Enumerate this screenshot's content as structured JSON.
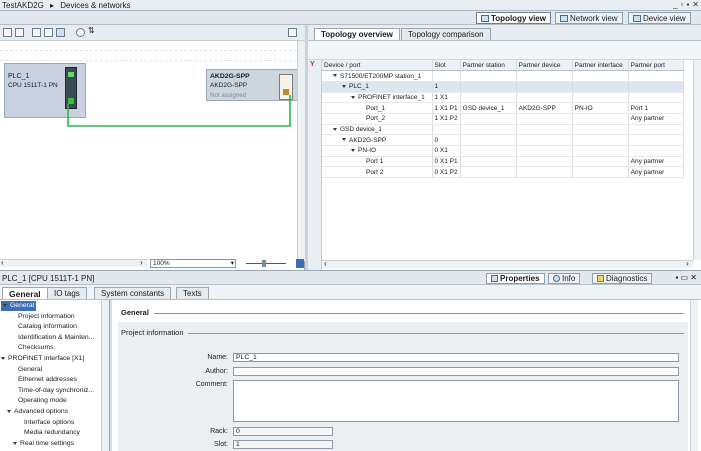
{
  "titlebar": {
    "project": "TestAKD2G",
    "separator": "▸",
    "section": "Devices & networks",
    "win_controls": [
      "_",
      "▫",
      "▪",
      "✕"
    ]
  },
  "view_tabs": {
    "topology": "Topology view",
    "network": "Network view",
    "device": "Device view"
  },
  "network": {
    "zoom": "100%",
    "plc": {
      "name": "PLC_1",
      "type": "CPU 1511T-1 PN"
    },
    "drive": {
      "name": "AKD2G-SPP",
      "type": "AKD2G-SPP",
      "status": "Not assigned"
    }
  },
  "topology": {
    "tabs": {
      "overview": "Topology overview",
      "comparison": "Topology comparison"
    },
    "columns": [
      "Device / port",
      "Slot",
      "Partner station",
      "Partner device",
      "Partner interface",
      "Partner port"
    ],
    "rows": [
      {
        "indent": 1,
        "expand": true,
        "name": "S71500/ET200MP station_1",
        "slot": "",
        "pstation": "",
        "pdevice": "",
        "pinterface": "",
        "pport": ""
      },
      {
        "indent": 2,
        "expand": true,
        "name": "PLC_1",
        "slot": "1",
        "pstation": "",
        "pdevice": "",
        "pinterface": "",
        "pport": ""
      },
      {
        "indent": 3,
        "expand": true,
        "name": "PROFINET interface_1",
        "slot": "1 X1",
        "pstation": "",
        "pdevice": "",
        "pinterface": "",
        "pport": ""
      },
      {
        "indent": 4,
        "expand": false,
        "name": "Port_1",
        "slot": "1 X1 P1",
        "pstation": "GSD device_1",
        "pdevice": "AKD2G-SPP",
        "pinterface": "PN-IO",
        "pport": "Port 1"
      },
      {
        "indent": 4,
        "expand": false,
        "name": "Port_2",
        "slot": "1 X1 P2",
        "pstation": "",
        "pdevice": "",
        "pinterface": "",
        "pport": "Any partner"
      },
      {
        "indent": 1,
        "expand": true,
        "name": "GSD device_1",
        "slot": "",
        "pstation": "",
        "pdevice": "",
        "pinterface": "",
        "pport": ""
      },
      {
        "indent": 2,
        "expand": true,
        "name": "AKD2G-SPP",
        "slot": "0",
        "pstation": "",
        "pdevice": "",
        "pinterface": "",
        "pport": ""
      },
      {
        "indent": 3,
        "expand": true,
        "name": "PN-IO",
        "slot": "0 X1",
        "pstation": "",
        "pdevice": "",
        "pinterface": "",
        "pport": ""
      },
      {
        "indent": 4,
        "expand": false,
        "name": "Port 1",
        "slot": "0 X1 P1",
        "pstation": "",
        "pdevice": "",
        "pinterface": "",
        "pport": "Any partner"
      },
      {
        "indent": 4,
        "expand": false,
        "name": "Port 2",
        "slot": "0 X1 P2",
        "pstation": "",
        "pdevice": "",
        "pinterface": "",
        "pport": "Any partner"
      }
    ]
  },
  "properties": {
    "title": "PLC_1 [CPU 1511T-1 PN]",
    "tabs": {
      "properties": "Properties",
      "info": "Info",
      "diagnostics": "Diagnostics"
    },
    "subtabs": [
      "General",
      "IO tags",
      "System constants",
      "Texts"
    ],
    "nav": [
      {
        "indent": 0,
        "label": "General",
        "selected": true,
        "expand": true
      },
      {
        "indent": 2,
        "label": "Project information"
      },
      {
        "indent": 2,
        "label": "Catalog information"
      },
      {
        "indent": 2,
        "label": "Identification & Mainten..."
      },
      {
        "indent": 2,
        "label": "Checksums"
      },
      {
        "indent": 0,
        "label": "PROFINET interface [X1]",
        "expand": true
      },
      {
        "indent": 2,
        "label": "General"
      },
      {
        "indent": 2,
        "label": "Ethernet addresses"
      },
      {
        "indent": 2,
        "label": "Time-of-day synchroniz..."
      },
      {
        "indent": 2,
        "label": "Operating mode"
      },
      {
        "indent": 1,
        "label": "Advanced options",
        "expand": true
      },
      {
        "indent": 3,
        "label": "Interface options"
      },
      {
        "indent": 3,
        "label": "Media redundancy"
      },
      {
        "indent": 2,
        "label": "Real time settings",
        "expand": true
      }
    ],
    "section_general": "General",
    "section_project": "Project information",
    "fields": {
      "name_label": "Name:",
      "name_value": "PLC_1",
      "author_label": "Author:",
      "author_value": "",
      "comment_label": "Comment:",
      "comment_value": "",
      "rack_label": "Rack:",
      "rack_value": "0",
      "slot_label": "Slot:",
      "slot_value": "1"
    }
  }
}
